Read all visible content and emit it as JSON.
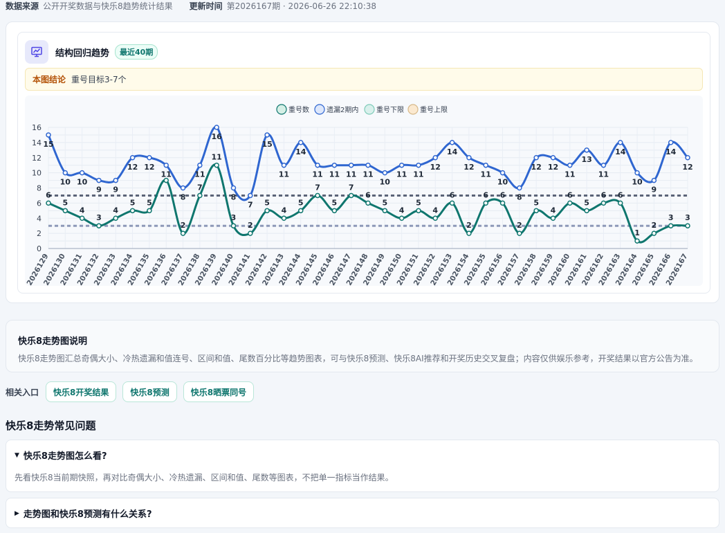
{
  "meta": {
    "source_label": "数据来源",
    "source_value": "公开开奖数据与快乐8趋势统计结果",
    "updated_label": "更新时间",
    "updated_value": "第2026167期 · 2026-06-26 22:10:38"
  },
  "card": {
    "title": "结构回归趋势",
    "badge": "最近40期",
    "conclusion_label": "本图结论",
    "conclusion_text": "重号目标3-7个"
  },
  "chart_data": {
    "type": "line",
    "categories": [
      "2026129",
      "2026130",
      "2026131",
      "2026132",
      "2026133",
      "2026134",
      "2026135",
      "2026136",
      "2026137",
      "2026138",
      "2026139",
      "2026140",
      "2026141",
      "2026142",
      "2026143",
      "2026144",
      "2026145",
      "2026146",
      "2026147",
      "2026148",
      "2026149",
      "2026150",
      "2026151",
      "2026152",
      "2026153",
      "2026154",
      "2026155",
      "2026156",
      "2026157",
      "2026158",
      "2026159",
      "2026160",
      "2026161",
      "2026162",
      "2026163",
      "2026164",
      "2026165",
      "2026166",
      "2026167"
    ],
    "series": [
      {
        "name": "重号数",
        "color": "#0f766e",
        "values": [
          6,
          5,
          4,
          3,
          4,
          5,
          5,
          9,
          2,
          7,
          11,
          3,
          2,
          5,
          4,
          5,
          7,
          5,
          7,
          6,
          5,
          4,
          5,
          4,
          6,
          2,
          6,
          6,
          2,
          5,
          4,
          6,
          5,
          6,
          6,
          1,
          2,
          3,
          3
        ],
        "labels": [
          "6",
          "5",
          "4",
          "3",
          "4",
          "5",
          "5",
          "",
          "2",
          "7",
          "11",
          "3",
          "2",
          "5",
          "4",
          "5",
          "7",
          "5",
          "7",
          "6",
          "5",
          "4",
          "5",
          "4",
          "6",
          "2",
          "6",
          "6",
          "2",
          "5",
          "4",
          "6",
          "5",
          "6",
          "6",
          "1",
          "2",
          "3",
          "3"
        ]
      },
      {
        "name": "遗漏2期内",
        "color": "#2f66d0",
        "values": [
          15,
          10,
          10,
          9,
          9,
          12,
          12,
          11,
          8,
          11,
          16,
          8,
          7,
          15,
          11,
          14,
          11,
          11,
          11,
          11,
          10,
          11,
          11,
          12,
          14,
          12,
          11,
          10,
          8,
          12,
          12,
          11,
          13,
          11,
          14,
          10,
          9,
          14,
          12
        ]
      },
      {
        "name": "重号下限",
        "color": "#8e99b8",
        "values": [
          3,
          3,
          3,
          3,
          3,
          3,
          3,
          3,
          3,
          3,
          3,
          3,
          3,
          3,
          3,
          3,
          3,
          3,
          3,
          3,
          3,
          3,
          3,
          3,
          3,
          3,
          3,
          3,
          3,
          3,
          3,
          3,
          3,
          3,
          3,
          3,
          3,
          3,
          3
        ]
      },
      {
        "name": "重号上限",
        "color": "#5b6478",
        "values": [
          7,
          7,
          7,
          7,
          7,
          7,
          7,
          7,
          7,
          7,
          7,
          7,
          7,
          7,
          7,
          7,
          7,
          7,
          7,
          7,
          7,
          7,
          7,
          7,
          7,
          7,
          7,
          7,
          7,
          7,
          7,
          7,
          7,
          7,
          7,
          7,
          7,
          7,
          7
        ]
      }
    ],
    "legend": [
      {
        "name": "重号数",
        "fill": "#d5efe6",
        "stroke": "#0f766e"
      },
      {
        "name": "遗漏2期内",
        "fill": "#dde7fb",
        "stroke": "#2f66d0"
      },
      {
        "name": "重号下限",
        "fill": "#d9f0ec",
        "stroke": "#7fcbb9"
      },
      {
        "name": "重号上限",
        "fill": "#fbe9d0",
        "stroke": "#d7b98a"
      }
    ],
    "ylim": [
      0,
      16
    ],
    "yticks": [
      "0",
      "2",
      "4",
      "6",
      "8",
      "10",
      "12",
      "14",
      "16"
    ],
    "grid": true,
    "legend_position": "top-center"
  },
  "description": {
    "title": "快乐8走势图说明",
    "text": "快乐8走势图汇总奇偶大小、冷热遗漏和值连号、区间和值、尾数百分比等趋势图表，可与快乐8预测、快乐8AI推荐和开奖历史交叉复盘；内容仅供娱乐参考，开奖结果以官方公告为准。"
  },
  "related": {
    "label": "相关入口",
    "links": [
      "快乐8开奖结果",
      "快乐8预测",
      "快乐8晒票同号"
    ]
  },
  "faq": {
    "heading": "快乐8走势常见问题",
    "items": [
      {
        "question": "快乐8走势图怎么看?",
        "answer": "先看快乐8当前期快照，再对比奇偶大小、冷热遗漏、区间和值、尾数等图表，不把单一指标当作结果。"
      },
      {
        "question": "走势图和快乐8预测有什么关系?"
      }
    ]
  }
}
